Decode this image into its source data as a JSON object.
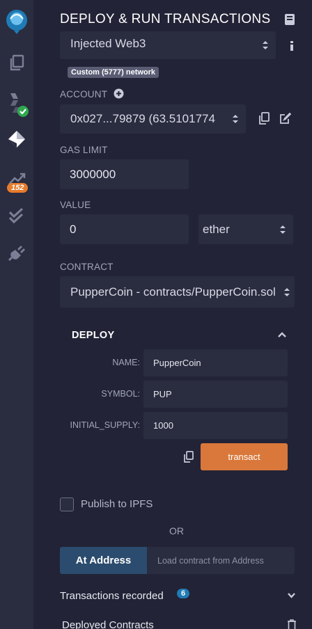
{
  "rail": {
    "badge_count": "152",
    "icons": [
      "remix-logo",
      "file-explorer-icon",
      "solidity-compiler-icon",
      "deploy-run-icon",
      "analysis-icon",
      "testing-icon",
      "plugin-manager-icon",
      "settings-icon"
    ]
  },
  "header": {
    "title": "DEPLOY & RUN TRANSACTIONS"
  },
  "environment": {
    "value": "Injected Web3",
    "network_badge": "Custom (5777) network"
  },
  "account": {
    "label": "ACCOUNT",
    "value": "0x027...79879 (63.5101774"
  },
  "gas_limit": {
    "label": "GAS LIMIT",
    "value": "3000000"
  },
  "value": {
    "label": "VALUE",
    "amount": "0",
    "unit": "ether"
  },
  "contract": {
    "label": "CONTRACT",
    "value": "PupperCoin - contracts/PupperCoin.sol"
  },
  "deploy": {
    "title": "DEPLOY",
    "params": [
      {
        "label": "NAME:",
        "value": "PupperCoin"
      },
      {
        "label": "SYMBOL:",
        "value": "PUP"
      },
      {
        "label": "INITIAL_SUPPLY:",
        "value": "1000"
      }
    ],
    "transact_label": "transact"
  },
  "publish": {
    "label": "Publish to IPFS",
    "checked": false
  },
  "or_label": "OR",
  "at_address": {
    "button_label": "At Address",
    "placeholder": "Load contract from Address"
  },
  "transactions": {
    "label": "Transactions recorded",
    "count": "6"
  },
  "deployed": {
    "label": "Deployed Contracts"
  },
  "colors": {
    "accent": "#d9783a",
    "badge": "#1f7bb5",
    "check_green": "#2ea84f",
    "rail_badge": "#e77b2c"
  }
}
